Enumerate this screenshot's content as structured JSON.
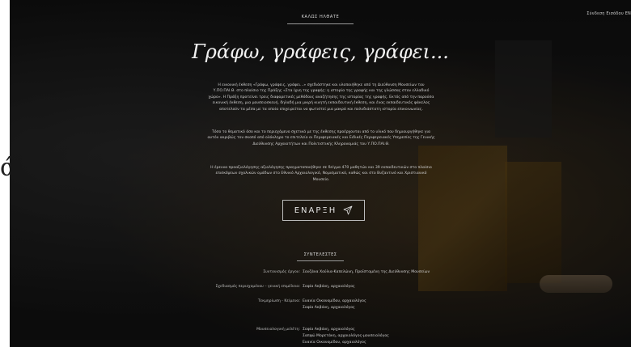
{
  "header": {
    "top_right": "Σύνδεση Εισόδου EN",
    "welcome": "ΚΑΛΩΣ ΗΛΘΑΤΕ",
    "title": "Γράφω, γράφεις, γράφει..."
  },
  "left_edge_glyph": "ά",
  "intro": {
    "paragraph1": "Η εικονική έκθεση «Γράφω, γράφεις, γράφει...» σχεδιάστηκε και υλοποιήθηκε από τη Διεύθυνση Μουσείων του Υ.ΠΟ.ΠΑΙ.Θ. στο πλαίσιο της Πράξης «Στα ίχνη της γραφής: η ιστορία της γραφής και της γλώσσας στον ελλαδικό χώρο». Η Πράξη προτείνει τρεις διαφορετικές μεθόδους αναζήτησης της ιστορίας της γραφής. Εκτός από την παρούσα εικονική έκθεση, μια μουσειοσκευή, δηλαδή μια μικρή κινητή εκπαιδευτική έκθεση, και ένας εκπαιδευτικός φάκελος αποτελούν τα μέσα με τα οποία επιχειρείται να φωτιστεί μια μακρά και πολυδιάστατη ιστορία επικοινωνίας.",
    "paragraph2": "Τόσο το θεματικό όσο και το περιεχόμενο σχετικά με της έκθεσης προέρχονται από το υλικό που δημιουργήθηκε για αυτόν ακριβώς τον σκοπό από ολόκληρο το επιτελείο οι Περιφερειακές και Ειδικές Περιφερειακές Υπηρεσίες της Γενικής Διεύθυνσης Αρχαιοτήτων και Πολιτιστικής Κληρονομιάς του Υ.ΠΟ.ΠΑΙ.Θ.",
    "paragraph3": "Η έρευνα προαξιολόγησης αξιολόγησης πραγματοποιήθηκε σε δείγμα 470 μαθητών και 39 εκπαιδευτικών στο πλαίσιο επισκέψεων σχολικών ομάδων στο Εθνικό Αρχαιολογικό, Νομισματικό, καθώς και στο Βυζαντινό και Χριστιανικό Μουσείο."
  },
  "start_button": {
    "label": "ΕΝΑΡΞΗ",
    "icon": "paper-plane-icon"
  },
  "credits": {
    "heading": "ΣΥΝΤΕΛΕΣΤΕΣ",
    "rows": [
      {
        "role": "Συντονισμός έργου:",
        "names": [
          "Σουζάνα Χούλια-Καπελώνη, Προϊσταμένη της Διεύθυνσης Μουσείων"
        ]
      },
      {
        "role": "Σχεδιασμός περιεχομένου – γενική επιμέλεια:",
        "names": [
          "Σοφία Ακβάνη, αρχαιολόγος"
        ]
      },
      {
        "role": "Τεκμηρίωση - Κείμενα:",
        "names": [
          "Ευανία Οικονομίδου, αρχαιολόγος",
          "Σοφία Ακβάνη, αρχαιολόγος"
        ]
      },
      {
        "role": "Μουσειολογική μελέτη:",
        "names": [
          "Σοφία Ακβάνη, αρχαιολόγος",
          "Σαπφώ Μορετάκη, αρχαιολόγος-μουσειολόγος",
          "Ευανία Οικονομίδου, αρχαιολόγος"
        ]
      }
    ]
  }
}
